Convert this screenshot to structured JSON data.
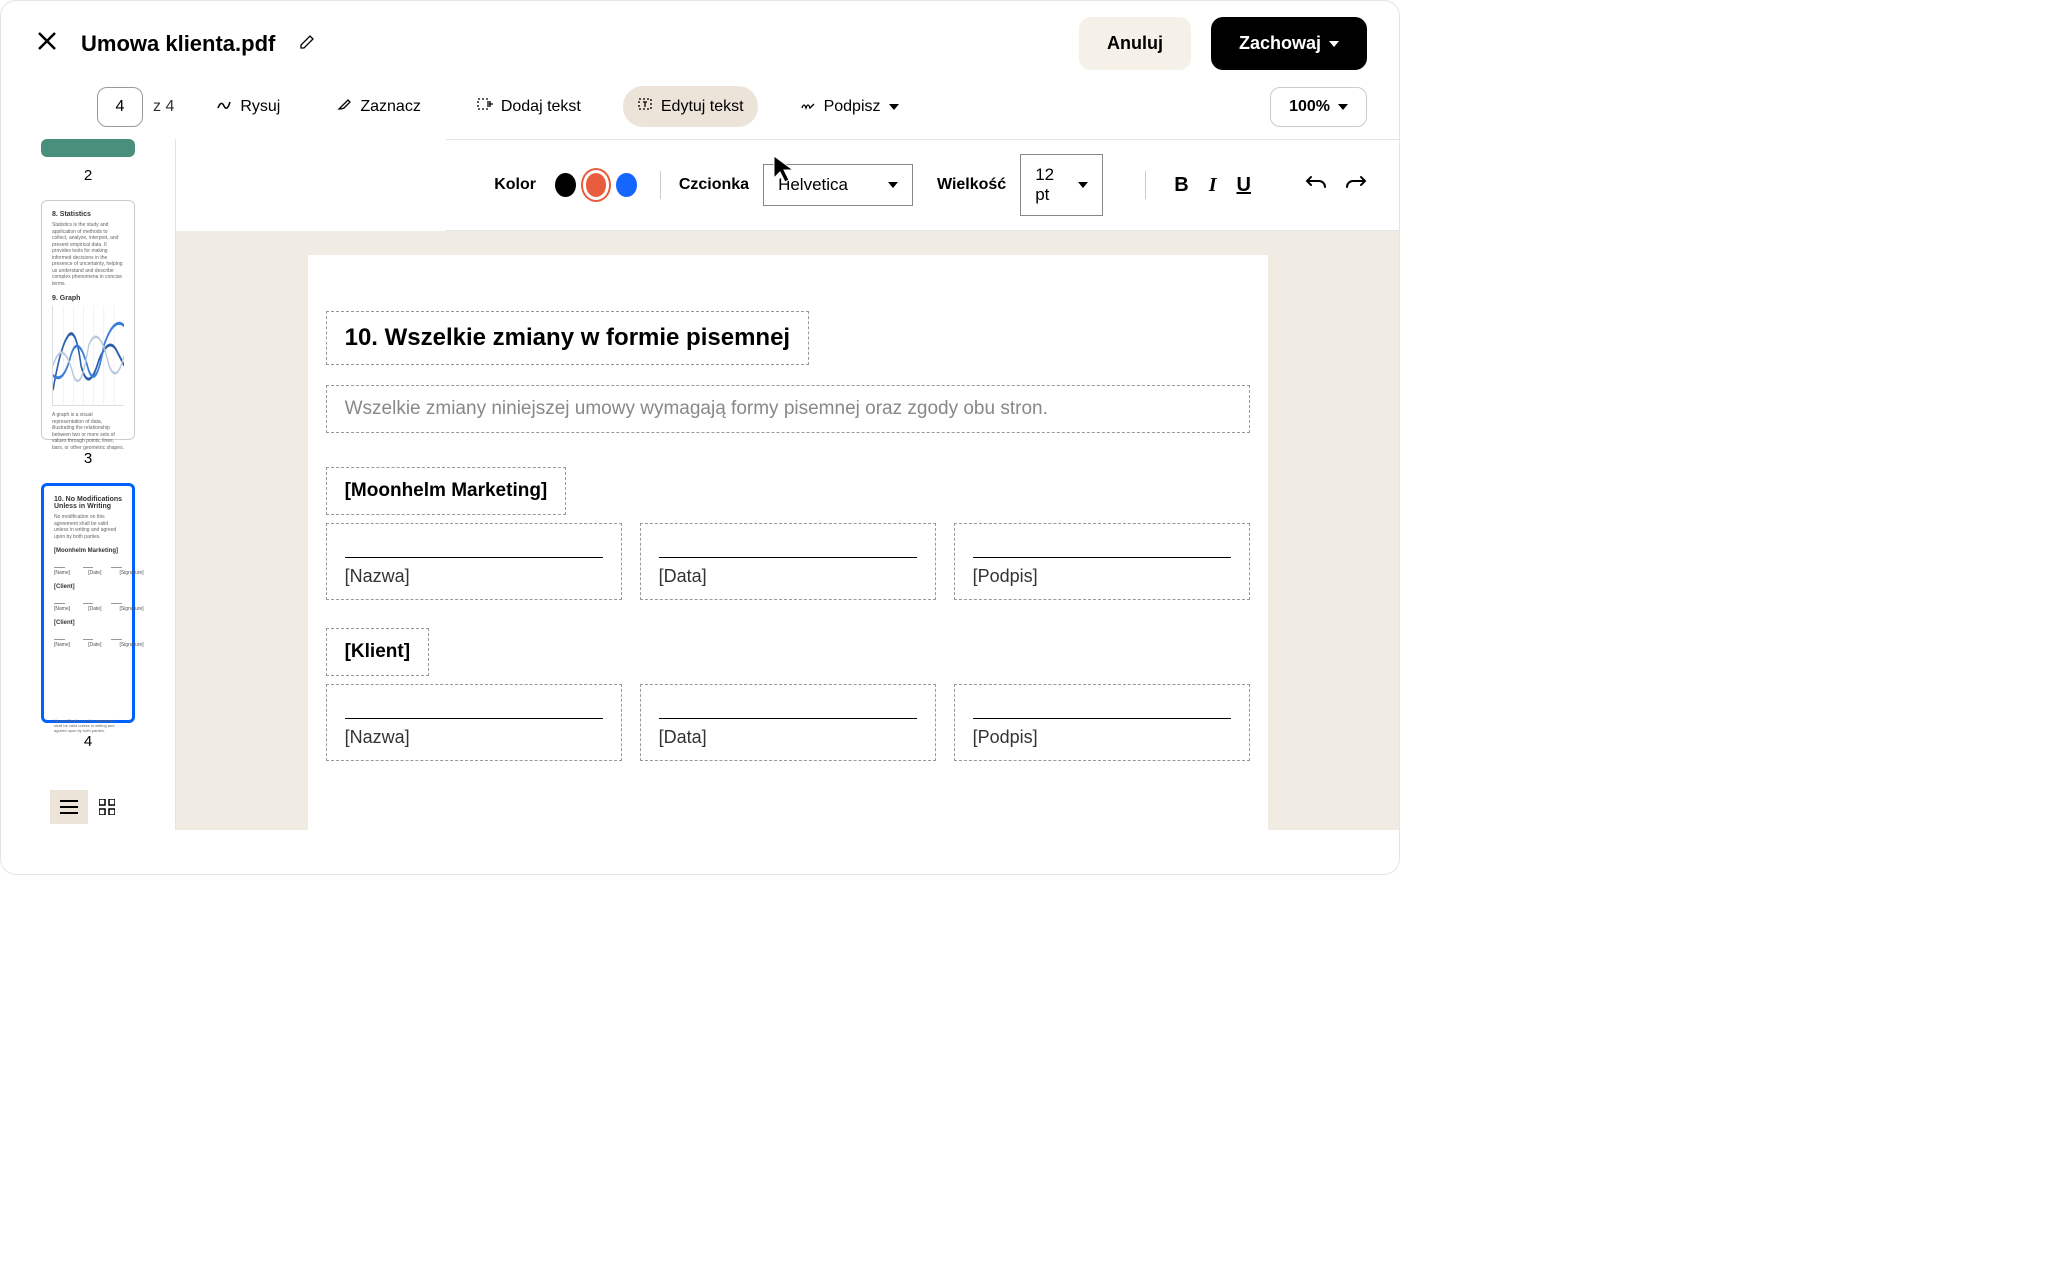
{
  "header": {
    "filename": "Umowa klienta.pdf",
    "cancel": "Anuluj",
    "save": "Zachowaj"
  },
  "toolbar": {
    "page_current": "4",
    "page_total": "z 4",
    "draw": "Rysuj",
    "highlight": "Zaznacz",
    "add_text": "Dodaj tekst",
    "edit_text": "Edytuj tekst",
    "sign": "Podpisz",
    "zoom": "100%"
  },
  "format": {
    "color_label": "Kolor",
    "colors": {
      "black": "#000000",
      "orange": "#e85d3d",
      "blue": "#1565ff"
    },
    "font_label": "Czcionka",
    "font_value": "Helvetica",
    "size_label": "Wielkość",
    "size_value": "12 pt"
  },
  "thumbs": {
    "p2": "2",
    "p3": "3",
    "p4": "4",
    "p3_h1": "8. Statistics",
    "p3_t1": "Statistics is the study and application of methods to collect, analyze, interpret, and present empirical data. It provides tools for making informed decisions in the presence of uncertainty, helping us understand and describe complex phenomena in concise terms.",
    "p3_h2": "9. Graph",
    "p3_t2": "A graph is a visual representation of data, illustrating the relationship between two or more sets of values through points, lines, bars, or other geometric shapes.",
    "p4_h1": "10. No Modifications Unless in Writing",
    "p4_t1": "No modification on this agreement shall be valid unless in writing and agreed upon by both parties.",
    "p4_party1": "[Moonhelm Marketing]",
    "p4_name": "[Name]",
    "p4_date": "[Date]",
    "p4_sig": "[Signature]",
    "p4_client": "[Client]",
    "p4_footer": "No modification on this agreement shall be valid unless in writing and agreed upon by both parties."
  },
  "doc": {
    "heading": "10. Wszelkie zmiany w formie pisemnej",
    "body": "Wszelkie zmiany niniejszej umowy wymagają formy pisemnej oraz zgody obu stron.",
    "party1": "[Moonhelm Marketing]",
    "party2": "[Klient]",
    "name": "[Nazwa]",
    "date": "[Data]",
    "sign": "[Podpis]"
  }
}
